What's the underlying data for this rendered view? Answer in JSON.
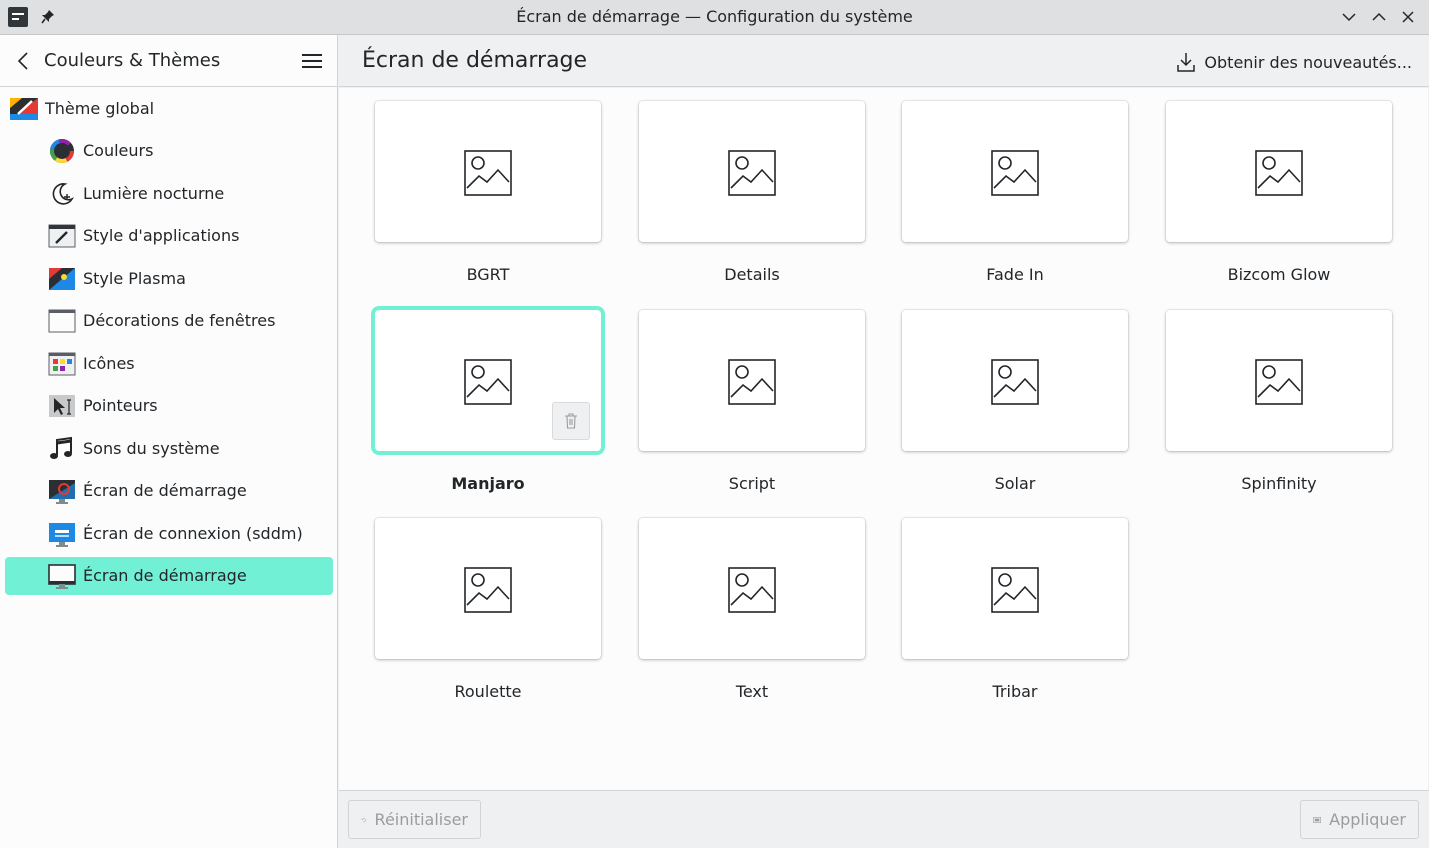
{
  "window": {
    "title": "Écran de démarrage — Configuration du système"
  },
  "sidebar": {
    "back_label": "Couleurs & Thèmes",
    "global_theme_label": "Thème global",
    "items": [
      {
        "label": "Couleurs",
        "icon": "color-wheel-icon"
      },
      {
        "label": "Lumière nocturne",
        "icon": "night-color-icon"
      },
      {
        "label": "Style d'applications",
        "icon": "application-style-icon"
      },
      {
        "label": "Style Plasma",
        "icon": "plasma-style-icon"
      },
      {
        "label": "Décorations de fenêtres",
        "icon": "window-decoration-icon"
      },
      {
        "label": "Icônes",
        "icon": "icons-icon"
      },
      {
        "label": "Pointeurs",
        "icon": "cursor-icon"
      },
      {
        "label": "Sons du système",
        "icon": "music-note-icon"
      },
      {
        "label": "Écran de démarrage",
        "icon": "boot-splash-icon"
      },
      {
        "label": "Écran de connexion (sddm)",
        "icon": "login-screen-icon"
      },
      {
        "label": "Écran de démarrage",
        "icon": "splash-screen-icon",
        "active": true
      }
    ]
  },
  "header": {
    "page_title": "Écran de démarrage",
    "get_new_label": "Obtenir des nouveautés..."
  },
  "themes": [
    {
      "name": "BGRT"
    },
    {
      "name": "Details"
    },
    {
      "name": "Fade In"
    },
    {
      "name": "Bizcom Glow"
    },
    {
      "name": "Manjaro",
      "selected": true
    },
    {
      "name": "Script"
    },
    {
      "name": "Solar"
    },
    {
      "name": "Spinfinity"
    },
    {
      "name": "Roulette"
    },
    {
      "name": "Text"
    },
    {
      "name": "Tribar"
    }
  ],
  "footer": {
    "reset_label": "Réinitialiser",
    "apply_label": "Appliquer"
  },
  "colors": {
    "accent": "#72f0d6",
    "text": "#232629",
    "disabled_text": "#9a9c9e"
  }
}
